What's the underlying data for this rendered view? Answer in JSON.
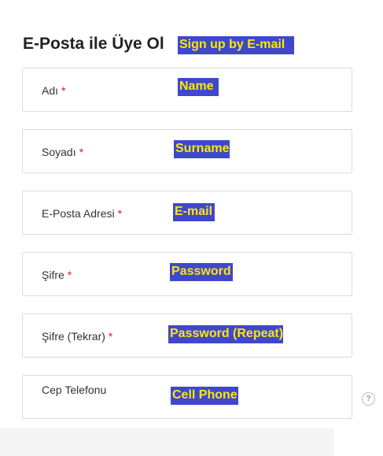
{
  "form": {
    "title": "E-Posta ile Üye Ol",
    "title_annotation": "Sign up by E-mail",
    "required_mark": "*",
    "fields": [
      {
        "label": "Adı",
        "annotation": "Name",
        "required": true
      },
      {
        "label": "Soyadı",
        "annotation": "Surname",
        "required": true
      },
      {
        "label": "E-Posta Adresi",
        "annotation": "E-mail",
        "required": true
      },
      {
        "label": "Şifre",
        "annotation": "Password",
        "required": true
      },
      {
        "label": "Şifre (Tekrar)",
        "annotation": "Password (Repeat)",
        "required": true
      },
      {
        "label": "Cep Telefonu",
        "annotation": "Cell Phone",
        "required": false
      }
    ],
    "help_icon": "question-mark-icon",
    "help_glyph": "?"
  },
  "colors": {
    "annotation_bg": "#3f48cc",
    "annotation_text": "#ffe800",
    "required": "#e5131d",
    "border": "#dcdcdc"
  }
}
